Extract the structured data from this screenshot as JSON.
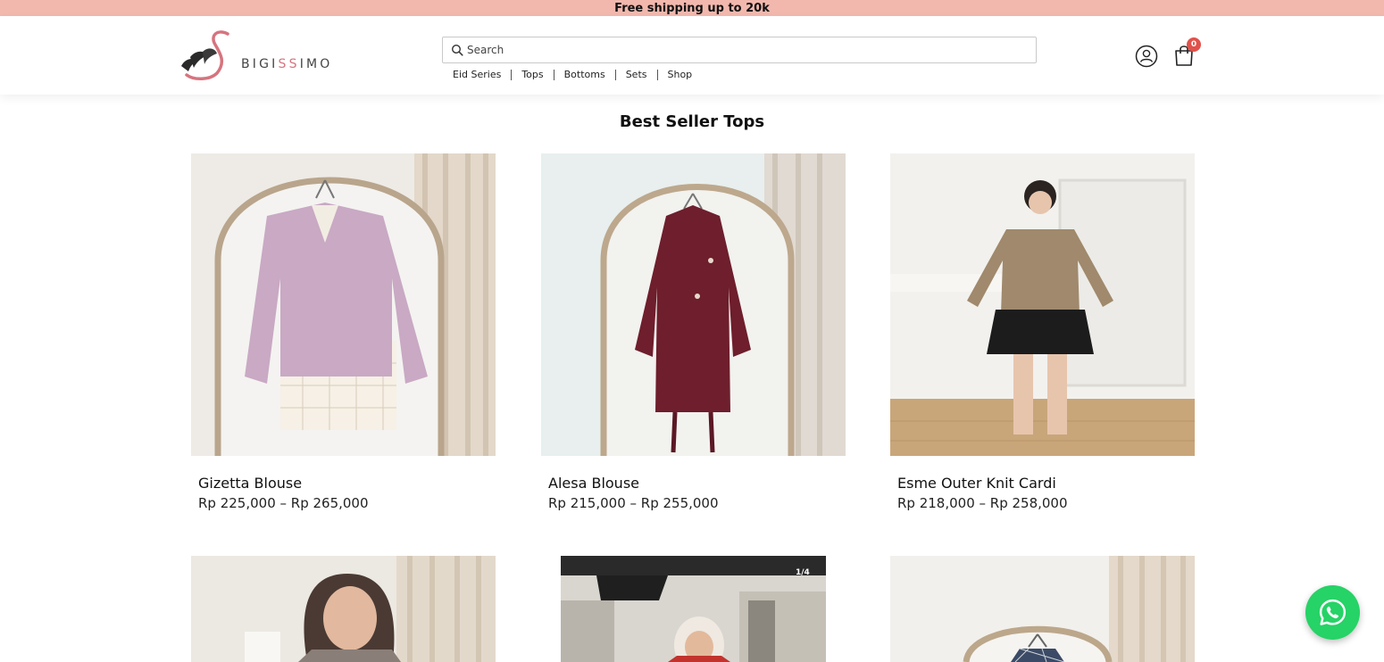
{
  "announcement": "Free shipping up to 20k",
  "brand": {
    "name_part1": "BIGI",
    "name_accent": "SS",
    "name_part2": "IMO",
    "accent_color": "#d6747e"
  },
  "search": {
    "placeholder": "Search"
  },
  "nav": {
    "items": [
      "Eid Series",
      "Tops",
      "Bottoms",
      "Sets",
      "Shop"
    ]
  },
  "cart": {
    "count": "0"
  },
  "icons": {
    "search": "search-icon",
    "account": "user-icon",
    "cart": "shopping-bag-icon",
    "chat": "whatsapp-icon"
  },
  "colors": {
    "announcement_bg": "#f2b8ae",
    "badge": "#e0524b",
    "whatsapp": "#25d366"
  },
  "section": {
    "title": "Best Seller Tops"
  },
  "products": [
    {
      "name": "Gizetta Blouse",
      "price": "Rp 225,000 – Rp 265,000"
    },
    {
      "name": "Alesa Blouse",
      "price": "Rp 215,000 – Rp 255,000"
    },
    {
      "name": "Esme Outer Knit Cardi",
      "price": "Rp 218,000 – Rp 258,000"
    },
    {
      "name": "",
      "price": ""
    },
    {
      "name": "",
      "price": "",
      "image_counter": "1/4"
    },
    {
      "name": "",
      "price": ""
    }
  ]
}
